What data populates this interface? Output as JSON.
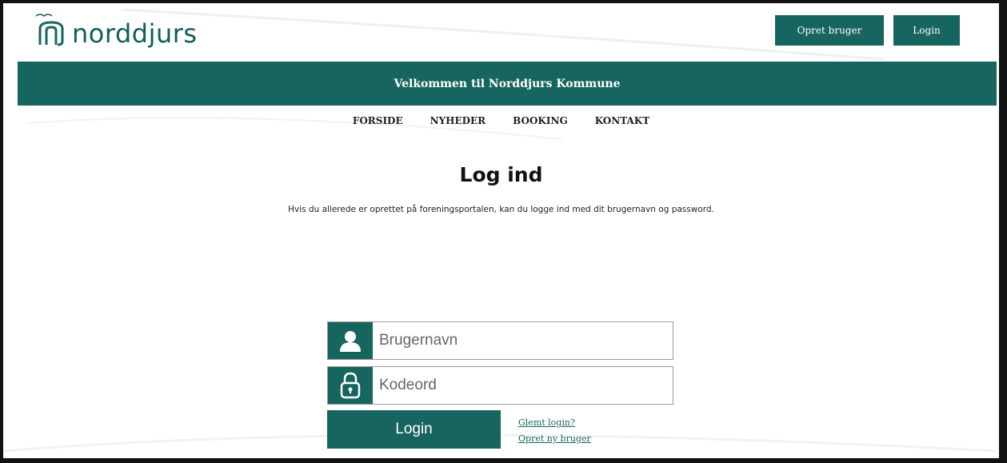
{
  "header": {
    "logo_text": "norddjurs",
    "logo_icon": "norddjurs-logo-icon",
    "create_user_label": "Opret bruger",
    "login_label": "Login"
  },
  "welcome": {
    "text": "Velkommen til Norddjurs Kommune"
  },
  "nav": {
    "items": [
      {
        "label": "FORSIDE"
      },
      {
        "label": "NYHEDER"
      },
      {
        "label": "BOOKING"
      },
      {
        "label": "KONTAKT"
      }
    ]
  },
  "main": {
    "title": "Log ind",
    "intro": "Hvis du allerede er oprettet på foreningsportalen, kan du logge ind med dit brugernavn og password."
  },
  "form": {
    "username_placeholder": "Brugernavn",
    "username_icon": "user-icon",
    "password_placeholder": "Kodeord",
    "password_icon": "lock-icon",
    "login_button": "Login",
    "forgot_link": "Glemt login?",
    "create_link": "Opret ny bruger"
  },
  "colors": {
    "brand": "#17655f",
    "background": "#ffffff"
  }
}
